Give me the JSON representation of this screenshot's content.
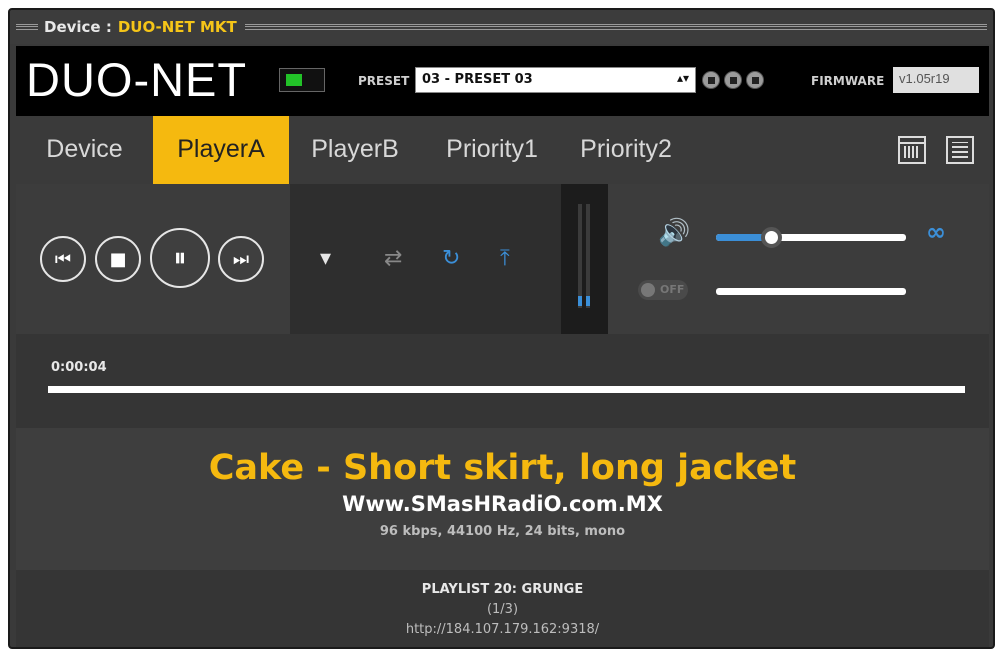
{
  "titlebar": {
    "label": "Device :",
    "device_name": "DUO-NET MKT"
  },
  "header": {
    "logo": "DUO-NET",
    "preset_label": "PRESET",
    "preset_value": "03 - PRESET 03",
    "firmware_label": "FIRMWARE",
    "firmware_value": "v1.05r19"
  },
  "tabs": [
    {
      "label": "Device",
      "active": false
    },
    {
      "label": "PlayerA",
      "active": true
    },
    {
      "label": "PlayerB",
      "active": false
    },
    {
      "label": "Priority1",
      "active": false
    },
    {
      "label": "Priority2",
      "active": false
    }
  ],
  "player": {
    "toggle_label": "OFF",
    "volume_level": 0.29,
    "vu_level": 0.1,
    "elapsed": "0:00:04",
    "progress": 0.0
  },
  "track": {
    "title": "Cake - Short skirt, long jacket",
    "station": "Www.SMasHRadiO.com.MX",
    "info": "96 kbps, 44100 Hz, 24 bits, mono"
  },
  "playlist": {
    "name": "PLAYLIST 20: GRUNGE",
    "counter": "(1/3)",
    "url": "http://184.107.179.162:9318/"
  },
  "colors": {
    "accent": "#f5b90f",
    "blue": "#3b8fd8",
    "background": "#3a3a3a"
  }
}
